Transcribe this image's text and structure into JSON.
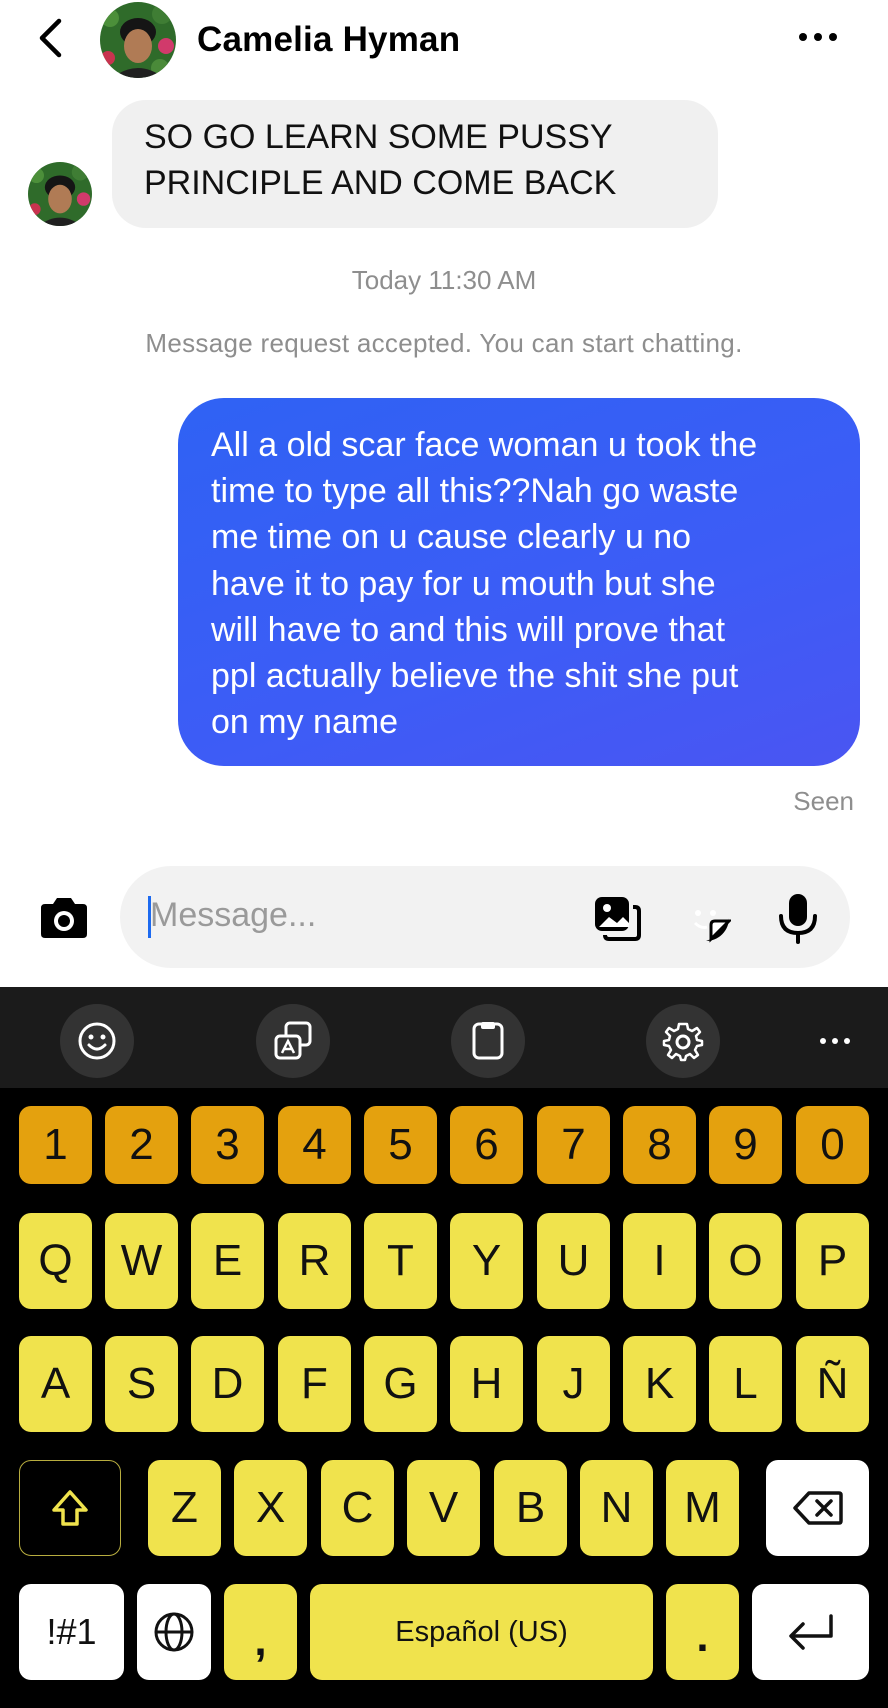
{
  "header": {
    "contact_name": "Camelia Hyman",
    "back_icon": "chevron-left-icon",
    "more_icon": "more-horizontal-icon"
  },
  "conversation": {
    "incoming_message": {
      "line1": "SO GO LEARN SOME PUSSY",
      "line2": "PRINCIPLE AND COME BACK"
    },
    "timestamp": "Today 11:30 AM",
    "system_message": "Message request accepted. You can start chatting.",
    "outgoing_message": {
      "lines": [
        "All a old scar face woman u took the",
        "time to type all this??Nah go waste",
        "me time on u cause clearly u no",
        "have it to pay for u mouth but she",
        "will have to and this will prove that",
        "ppl actually believe the shit she put",
        "on my name"
      ]
    },
    "status": "Seen"
  },
  "composer": {
    "placeholder": "Message...",
    "icons": [
      "camera-icon",
      "gallery-icon",
      "sticker-icon",
      "microphone-icon"
    ]
  },
  "keyboard": {
    "toolbar_icons": [
      "emoji-icon",
      "translate-icon",
      "clipboard-icon",
      "settings-icon",
      "more-icon"
    ],
    "number_row": [
      "1",
      "2",
      "3",
      "4",
      "5",
      "6",
      "7",
      "8",
      "9",
      "0"
    ],
    "row1": [
      "Q",
      "W",
      "E",
      "R",
      "T",
      "Y",
      "U",
      "I",
      "O",
      "P"
    ],
    "row2": [
      "A",
      "S",
      "D",
      "F",
      "G",
      "H",
      "J",
      "K",
      "L",
      "Ñ"
    ],
    "row3": [
      "Z",
      "X",
      "C",
      "V",
      "B",
      "N",
      "M"
    ],
    "symbols_label": "!#1",
    "comma_label": ",",
    "space_label": "Español (US)",
    "period_label": ".",
    "colors": {
      "number_keys": "#e4a10e",
      "letter_keys": "#f0e34d",
      "bubble_blue": "#3b5ef6"
    }
  }
}
